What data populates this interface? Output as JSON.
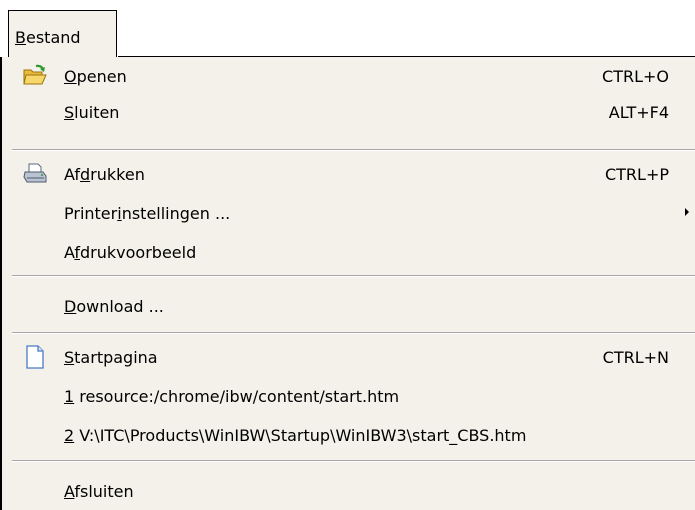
{
  "menubar": {
    "tab": {
      "pre": "",
      "accel": "B",
      "post": "estand"
    }
  },
  "menu": {
    "items": [
      {
        "pre": "",
        "accel": "O",
        "post": "penen",
        "shortcut": "CTRL+O",
        "icon": "folder-open-icon"
      },
      {
        "pre": "",
        "accel": "S",
        "post": "luiten",
        "shortcut": "ALT+F4",
        "icon": ""
      },
      {
        "pre": "Af",
        "accel": "d",
        "post": "rukken",
        "shortcut": "CTRL+P",
        "icon": "printer-icon"
      },
      {
        "pre": "Printer",
        "accel": "i",
        "post": "nstellingen ...",
        "shortcut": "",
        "icon": "",
        "submenu": true
      },
      {
        "pre": "A",
        "accel": "f",
        "post": "drukvoorbeeld",
        "shortcut": "",
        "icon": ""
      },
      {
        "pre": "",
        "accel": "D",
        "post": "ownload ...",
        "shortcut": "",
        "icon": ""
      },
      {
        "pre": "",
        "accel": "S",
        "post": "tartpagina",
        "shortcut": "CTRL+N",
        "icon": "blank-page-icon"
      },
      {
        "pre": "",
        "accel": "1",
        "post": " resource:/chrome/ibw/content/start.htm",
        "shortcut": "",
        "icon": ""
      },
      {
        "pre": "",
        "accel": "2",
        "post": " V:\\ITC\\Products\\WinIBW\\Startup\\WinIBW3\\start_CBS.htm",
        "shortcut": "",
        "icon": ""
      },
      {
        "pre": "",
        "accel": "A",
        "post": "fsluiten",
        "shortcut": "",
        "icon": ""
      }
    ]
  },
  "colors": {
    "menu_background": "#f3f1e9",
    "separator": "#a7a6aa"
  }
}
